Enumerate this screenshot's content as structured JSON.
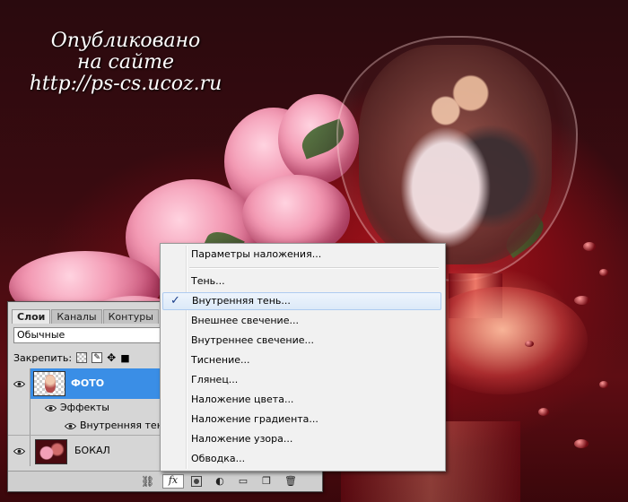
{
  "watermark": {
    "line1": "Опубликовано",
    "line2": "на сайте",
    "line3": "http://ps-cs.ucoz.ru"
  },
  "layers_panel": {
    "tabs": [
      "Слои",
      "Каналы",
      "Контуры"
    ],
    "active_tab": "Слои",
    "blend_mode": "Обычные",
    "lock_label": "Закрепить:",
    "lock_icons": [
      "lock-transparent-icon",
      "lock-image-icon",
      "lock-position-icon",
      "lock-all-icon"
    ],
    "layers": [
      {
        "name": "ФОТО",
        "selected": true,
        "visible": true,
        "thumbnail": "checkerboard-photo"
      },
      {
        "name": "Эффекты",
        "kind": "effects-group",
        "visible": true
      },
      {
        "name": "Внутренняя тень",
        "kind": "effect",
        "visible": true
      },
      {
        "name": "БОКАЛ",
        "selected": false,
        "visible": true,
        "thumbnail": "roses-image"
      }
    ],
    "footer_icons": [
      "link-icon",
      "fx-icon",
      "mask-icon",
      "adjustment-icon",
      "group-icon",
      "new-layer-icon",
      "trash-icon"
    ],
    "fx_label": "fx"
  },
  "context_menu": {
    "items": [
      {
        "label": "Параметры наложения...",
        "checked": false
      },
      {
        "label": "Тень...",
        "checked": false
      },
      {
        "label": "Внутренняя тень...",
        "checked": true,
        "highlighted": true
      },
      {
        "label": "Внешнее свечение...",
        "checked": false
      },
      {
        "label": "Внутреннее свечение...",
        "checked": false
      },
      {
        "label": "Тиснение...",
        "checked": false
      },
      {
        "label": "Глянец...",
        "checked": false
      },
      {
        "label": "Наложение цвета...",
        "checked": false
      },
      {
        "label": "Наложение градиента...",
        "checked": false
      },
      {
        "label": "Наложение узора...",
        "checked": false
      },
      {
        "label": "Обводка...",
        "checked": false
      }
    ],
    "check_glyph": "✓"
  },
  "colors": {
    "selection": "#3a8ee6",
    "menu_highlight": "#dce9f8",
    "background": "#5e0d13"
  }
}
